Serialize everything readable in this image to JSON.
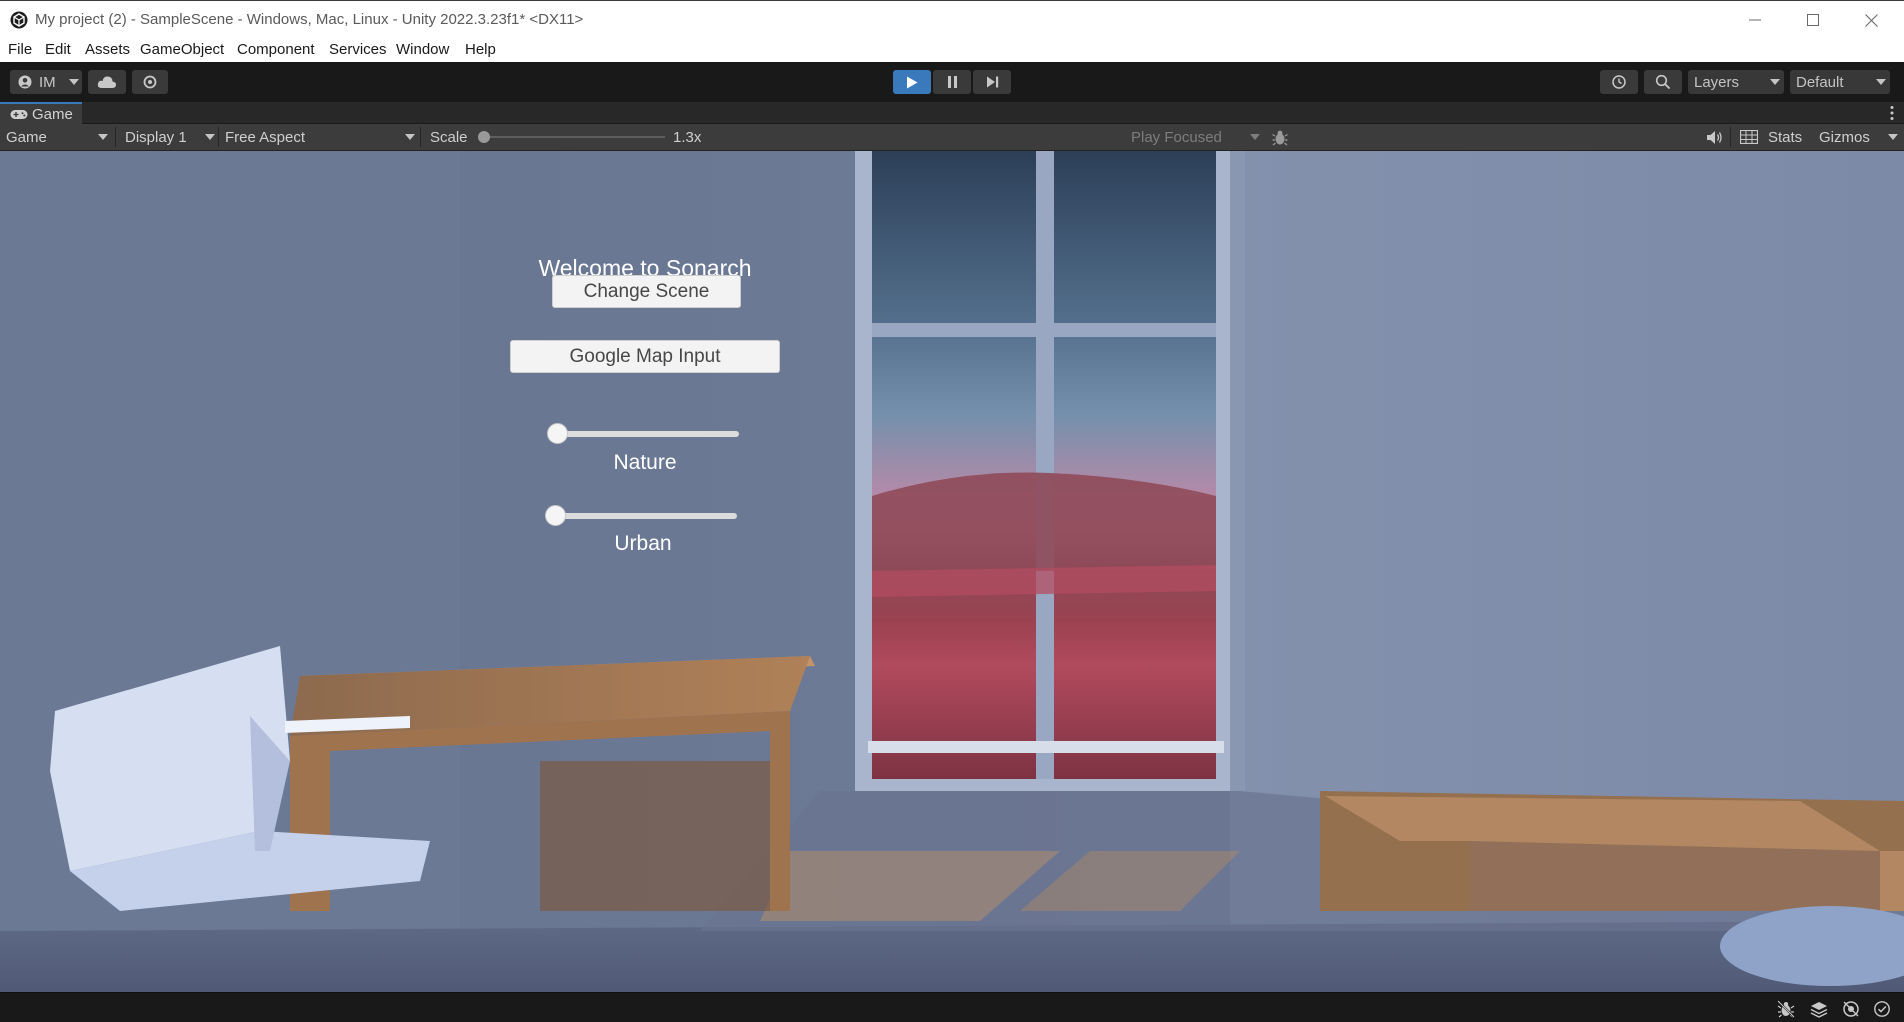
{
  "window": {
    "title": "My project (2) - SampleScene - Windows, Mac, Linux - Unity 2022.3.23f1* <DX11>",
    "app_icon": "unity-logo-icon",
    "controls": [
      "minimize-icon",
      "maximize-icon",
      "close-icon"
    ]
  },
  "menu": {
    "items": [
      "File",
      "Edit",
      "Assets",
      "GameObject",
      "Component",
      "Services",
      "Window",
      "Help"
    ]
  },
  "toolbar": {
    "account_label": "IM",
    "play_active": true,
    "layers_label": "Layers",
    "layout_label": "Default",
    "accent_color": "#3a79bb"
  },
  "game_tab": {
    "label": "Game"
  },
  "game_toolbar": {
    "view_mode": "Game",
    "display": "Display 1",
    "aspect": "Free Aspect",
    "scale_label": "Scale",
    "scale_value": "1.3x",
    "scale_fraction": 0.0,
    "play_mode": "Play Focused",
    "stats_label": "Stats",
    "gizmos_label": "Gizmos"
  },
  "game_ui": {
    "title": "Welcome to Sonarch",
    "buttons": [
      "Change Scene",
      "Google Map Input"
    ],
    "sliders": [
      {
        "label": "Nature",
        "value": 0.0
      },
      {
        "label": "Urban",
        "value": 0.0
      }
    ]
  }
}
